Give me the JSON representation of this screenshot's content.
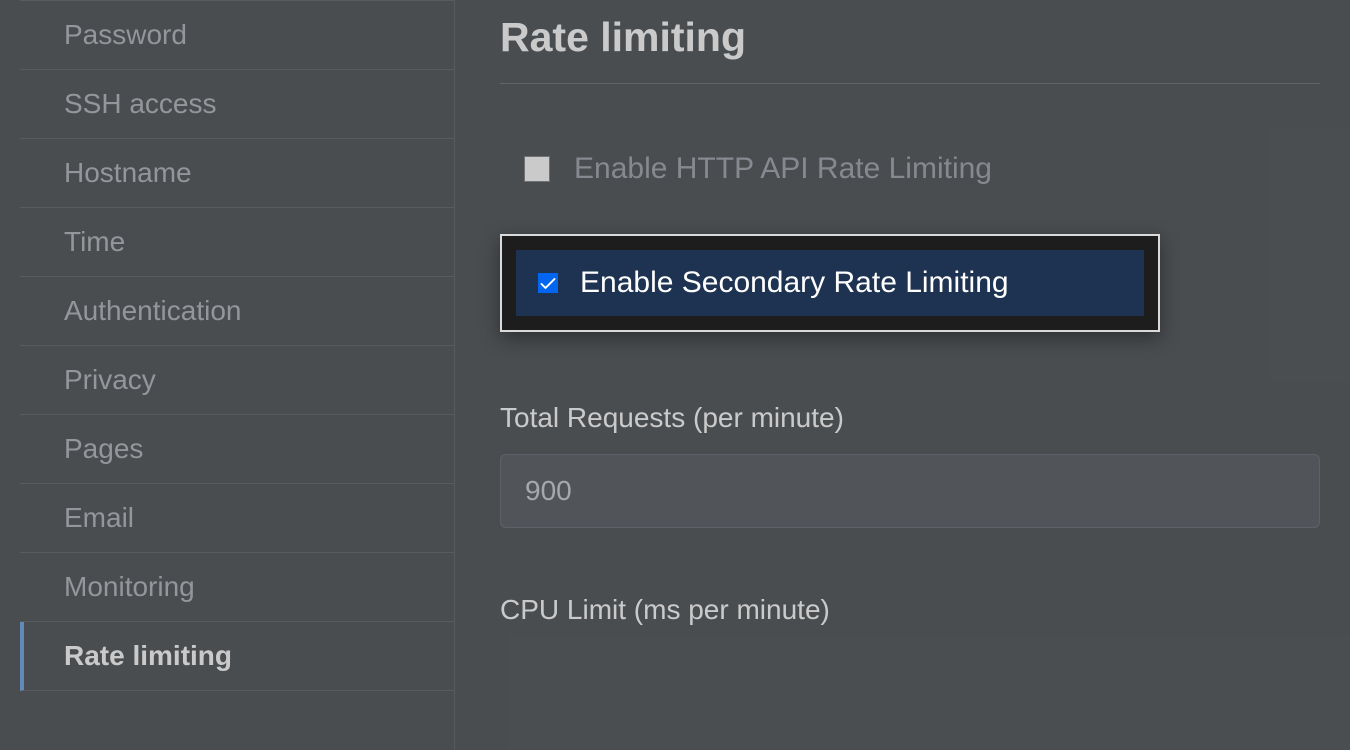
{
  "sidebar": {
    "items": [
      {
        "label": "Password",
        "active": false
      },
      {
        "label": "SSH access",
        "active": false
      },
      {
        "label": "Hostname",
        "active": false
      },
      {
        "label": "Time",
        "active": false
      },
      {
        "label": "Authentication",
        "active": false
      },
      {
        "label": "Privacy",
        "active": false
      },
      {
        "label": "Pages",
        "active": false
      },
      {
        "label": "Email",
        "active": false
      },
      {
        "label": "Monitoring",
        "active": false
      },
      {
        "label": "Rate limiting",
        "active": true
      }
    ]
  },
  "main": {
    "title": "Rate limiting",
    "http_api": {
      "label": "Enable HTTP API Rate Limiting",
      "checked": false
    },
    "secondary": {
      "label": "Enable Secondary Rate Limiting",
      "checked": true
    },
    "total_requests": {
      "label": "Total Requests (per minute)",
      "value": "900"
    },
    "cpu_limit": {
      "label": "CPU Limit (ms per minute)"
    }
  }
}
